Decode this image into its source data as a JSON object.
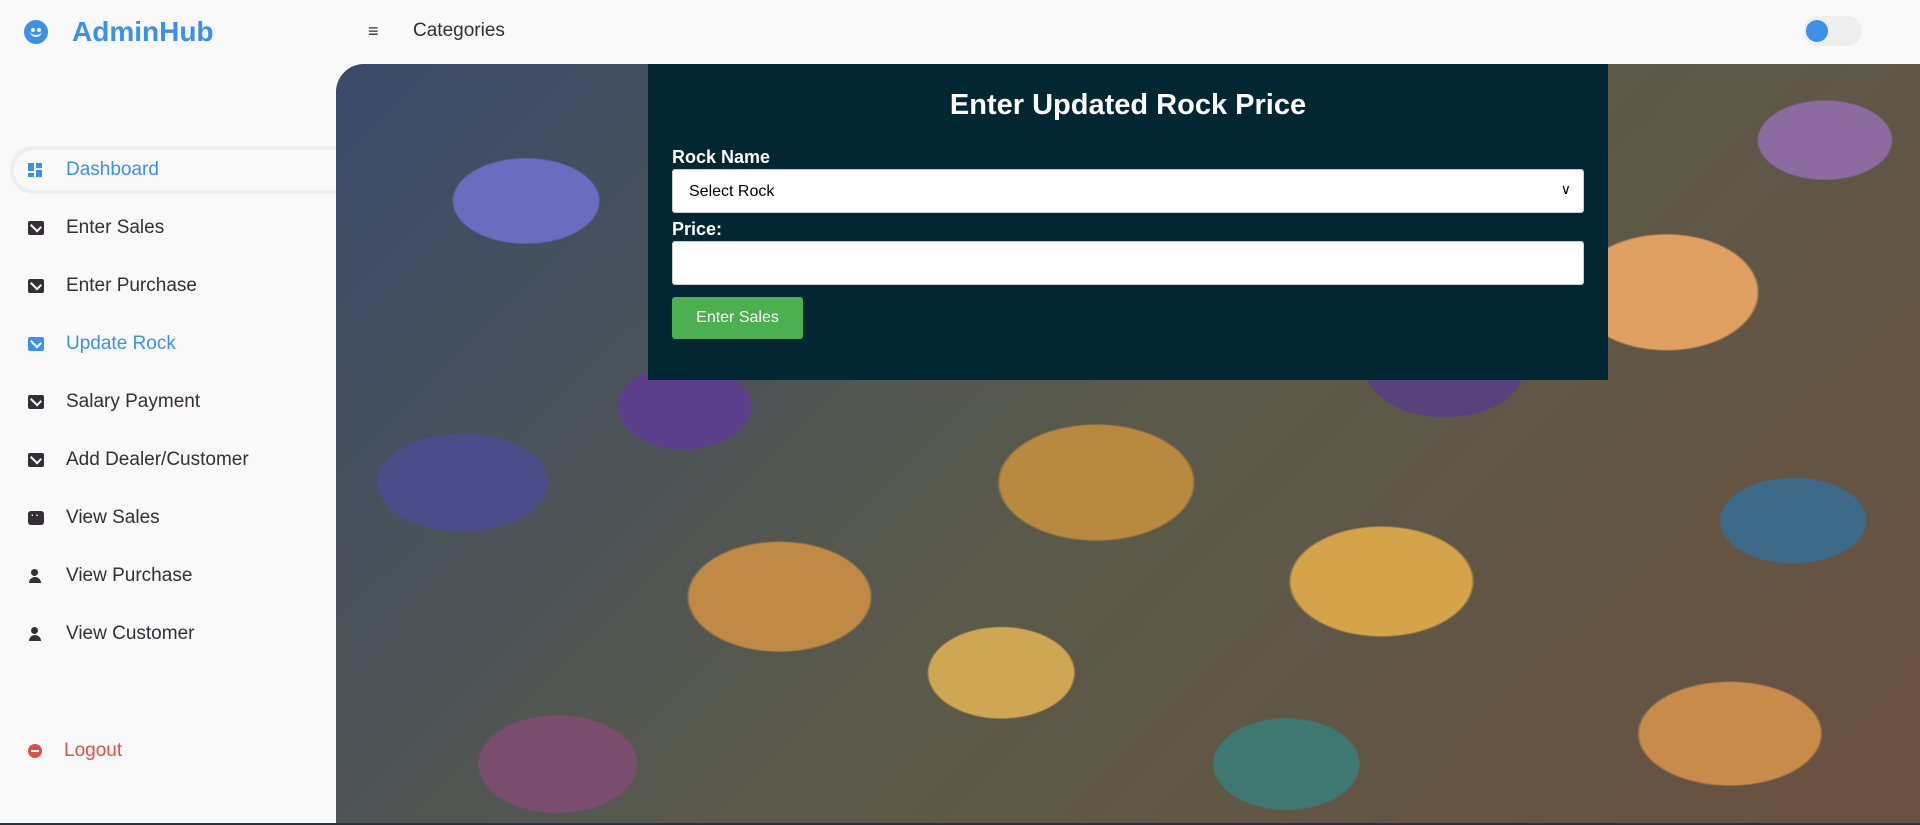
{
  "brand": {
    "name": "AdminHub",
    "icon": "smile-icon"
  },
  "sidebar": {
    "items": [
      {
        "label": "Dashboard",
        "icon": "dashboard-icon"
      },
      {
        "label": "Enter Sales",
        "icon": "mail-icon"
      },
      {
        "label": "Enter Purchase",
        "icon": "mail-icon"
      },
      {
        "label": "Update Rock",
        "icon": "mail-icon"
      },
      {
        "label": "Salary Payment",
        "icon": "mail-icon"
      },
      {
        "label": "Add Dealer/Customer",
        "icon": "mail-icon"
      },
      {
        "label": "View Sales",
        "icon": "chat-icon"
      },
      {
        "label": "View Purchase",
        "icon": "user-icon"
      },
      {
        "label": "View Customer",
        "icon": "user-icon"
      }
    ],
    "logout_label": "Logout"
  },
  "topbar": {
    "menu_icon": "≡",
    "nav_link": "Categories",
    "toggle_on": false
  },
  "form": {
    "title": "Enter Updated Rock Price",
    "rock_label": "Rock Name",
    "rock_select_value": "Select Rock",
    "price_label": "Price:",
    "price_value": "",
    "submit_label": "Enter Sales"
  },
  "colors": {
    "accent": "#3c91e6",
    "panel": "#022632",
    "submit": "#4caf50",
    "logout": "#db504a"
  }
}
